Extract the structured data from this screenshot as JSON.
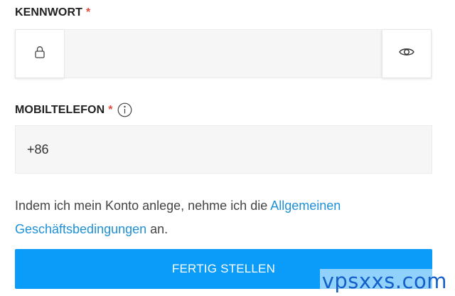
{
  "password": {
    "label": "KENNWORT",
    "required_mark": "*",
    "value": "",
    "lock_icon": "lock-icon",
    "toggle_icon": "eye-icon"
  },
  "mobile": {
    "label": "MOBILTELEFON",
    "required_mark": "*",
    "info_icon": "info-icon",
    "country_code": "+86"
  },
  "terms": {
    "text_before": "Indem ich mein Konto anlege, nehme ich die ",
    "link_text": "Allgemeinen Geschäftsbedingungen",
    "text_after": " an."
  },
  "submit_label": "FERTIG STELLEN",
  "watermark": "vpsxxs.com",
  "colors": {
    "accent": "#0a9cf8",
    "link": "#1e90d8",
    "required": "#e64a3c",
    "field_bg": "#f6f6f6"
  }
}
